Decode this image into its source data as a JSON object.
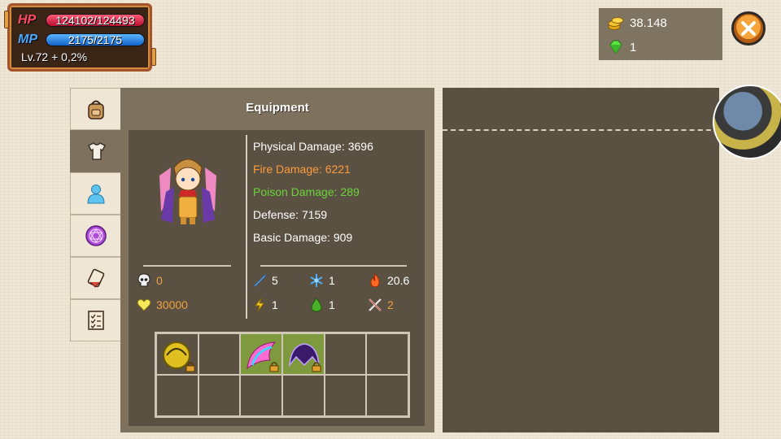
{
  "hud": {
    "hp_label": "HP",
    "hp_value": "124102/124493",
    "mp_label": "MP",
    "mp_value": "2175/2175",
    "level": "Lv.72 + 0,2%"
  },
  "currency": {
    "gold": "38.148",
    "gems": "1"
  },
  "tabs": [
    {
      "icon": "backpack-icon",
      "active": false
    },
    {
      "icon": "armor-icon",
      "active": true
    },
    {
      "icon": "person-icon",
      "active": false
    },
    {
      "icon": "magic-circle-icon",
      "active": false
    },
    {
      "icon": "scroll-icon",
      "active": false
    },
    {
      "icon": "checklist-icon",
      "active": false
    }
  ],
  "panel": {
    "title": "Equipment",
    "stats": {
      "physical_label": "Physical Damage:",
      "physical_value": "3696",
      "fire_label": "Fire Damage:",
      "fire_value": "6221",
      "poison_label": "Poison Damage:",
      "poison_value": "289",
      "defense_label": "Defense:",
      "defense_value": "7159",
      "basic_label": "Basic Damage:",
      "basic_value": "909"
    },
    "kills": "0",
    "health": "30000",
    "attributes": {
      "sword": "5",
      "ice": "1",
      "fire": "20.6",
      "lightning": "1",
      "poison": "1",
      "crossed_swords": "2"
    }
  },
  "colors": {
    "panel": "#7e725f",
    "inner": "#5b5142",
    "fire": "#ff9a3c",
    "poison": "#6bd43b",
    "accent_orange": "#f0a040"
  }
}
